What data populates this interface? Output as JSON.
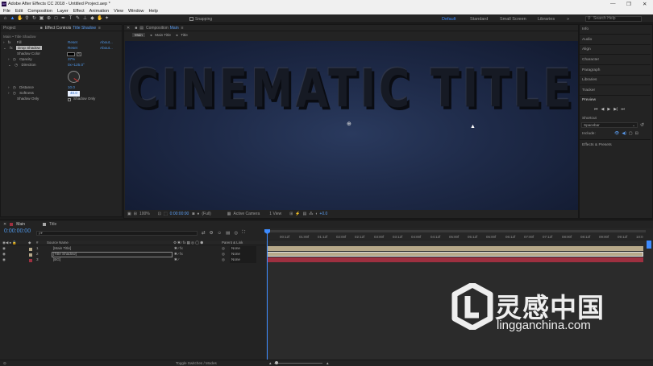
{
  "window": {
    "title": "Adobe After Effects CC 2018 - Untitled Project.aep *",
    "controls": [
      "—",
      "❐",
      "✕"
    ]
  },
  "menu": [
    "File",
    "Edit",
    "Composition",
    "Layer",
    "Effect",
    "Animation",
    "View",
    "Window",
    "Help"
  ],
  "toolbar": {
    "snapping_label": "Snapping",
    "workspaces": [
      "Default",
      "Standard",
      "Small Screen",
      "Libraries"
    ],
    "active_workspace": "Default",
    "search_placeholder": "Search Help"
  },
  "project_panel": {
    "tab_project": "Project",
    "tab_effect_controls": "Effect Controls",
    "effect_target": "Title Shadow",
    "breadcrumb": "Main • Title Shadow",
    "effects": [
      {
        "name": "Fill",
        "reset": "Reset",
        "about": "About..."
      },
      {
        "name": "Drop Shadow",
        "reset": "Reset",
        "about": "About..."
      }
    ],
    "properties": [
      {
        "name": "Shadow Color",
        "value": ""
      },
      {
        "name": "Opacity",
        "value": "37%"
      },
      {
        "name": "Direction",
        "value": "0x+125.0°"
      },
      {
        "name": "Distance",
        "value": "10.0"
      },
      {
        "name": "Softness",
        "value": "40.0"
      },
      {
        "name": "Shadow Only",
        "value": "Shadow Only"
      }
    ]
  },
  "composition": {
    "tab_label": "Composition",
    "comp_name": "Main",
    "breadcrumbs": [
      "Main",
      "Main Title",
      "Title"
    ],
    "title_text": "CINEMATIC TITLE",
    "bottom_bar": {
      "zoom": "100%",
      "timecode": "0:00:00:00",
      "resolution": "(Full)",
      "camera": "Active Camera",
      "views": "1 View",
      "offset": "+0.0"
    }
  },
  "right_panel": {
    "items": [
      "Info",
      "Audio",
      "Align",
      "Character",
      "Paragraph",
      "Libraries",
      "Tracker",
      "Preview"
    ],
    "shortcut_label": "Shortcut",
    "shortcut_value": "Spacebar",
    "include_label": "Include:",
    "effects_presets": "Effects & Presets"
  },
  "timeline": {
    "tabs": [
      "Main",
      "Title"
    ],
    "timecode": "0:00:00:00",
    "search_placeholder": "ρ▾",
    "col_source_name": "Source Name",
    "col_parent": "Parent & Link",
    "layers": [
      {
        "num": "1",
        "name": "[Main Title]",
        "parent": "None",
        "color": "#b7a98a"
      },
      {
        "num": "2",
        "name": "[Title Shadow]",
        "parent": "None",
        "color": "#b7a98a"
      },
      {
        "num": "3",
        "name": "[BG]",
        "parent": "None",
        "color": "#9e3040"
      }
    ],
    "ticks": [
      "00:12f",
      "01:00f",
      "01:12f",
      "02:00f",
      "02:12f",
      "03:00f",
      "03:12f",
      "04:00f",
      "04:12f",
      "05:00f",
      "05:12f",
      "06:00f",
      "06:12f",
      "07:00f",
      "07:12f",
      "08:00f",
      "08:12f",
      "09:00f",
      "09:12f",
      "10:0"
    ],
    "toggle_label": "Toggle Switches / Modes"
  },
  "watermark": {
    "text_cn": "灵感中国",
    "url": "lingganchina.com"
  }
}
